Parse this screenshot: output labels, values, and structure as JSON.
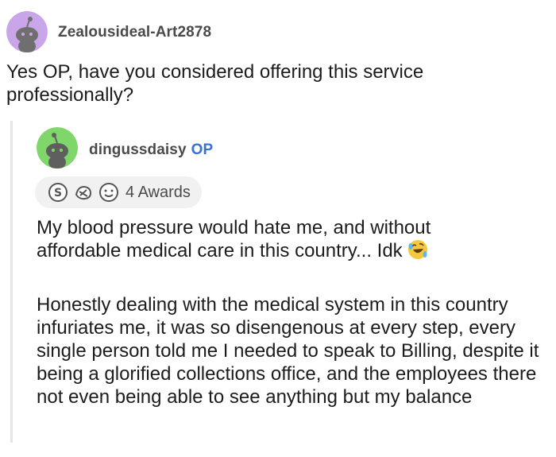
{
  "parent_comment": {
    "username": "Zealousideal-Art2878",
    "avatar_icon": "snoo-avatar-purple-icon",
    "body": "Yes OP, have you considered offering this service professionally?"
  },
  "reply_comment": {
    "username": "dingussdaisy",
    "op_badge": "OP",
    "avatar_icon": "snoo-avatar-green-icon",
    "awards": {
      "icons": [
        "silver-award-icon",
        "wholesome-seal-award-icon",
        "helpful-award-icon"
      ],
      "label": "4 Awards"
    },
    "paragraph_1": "My blood pressure would hate me, and without affordable medical care in this country... Idk",
    "paragraph_1_emoji": "rolling-on-floor-laughing-emoji-icon",
    "paragraph_2": "Honestly dealing with the medical system in this country infuriates me, it was so disengenous at every step, every single person told me I needed to speak to Billing, despite it being a glorified collections office, and the employees there not even being able to see anything but my balance"
  },
  "colors": {
    "op_badge": "#3b6fd8",
    "parent_avatar_bg": "#c9a6e9",
    "reply_avatar_bg": "#7fd66a",
    "thread_line": "#e6e6e6",
    "awards_pill_bg": "#f1f1f1"
  }
}
